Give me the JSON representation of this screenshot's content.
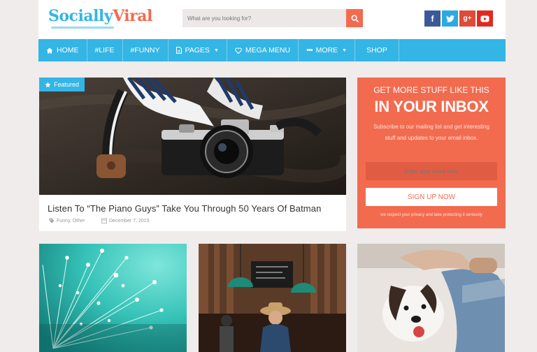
{
  "header": {
    "logo_part1": "Socially",
    "logo_part2": "Viral",
    "search_placeholder": "What are you looking for?",
    "social": [
      "f",
      "t",
      "g+",
      "youtube"
    ]
  },
  "nav": {
    "items": [
      {
        "label": "HOME",
        "icon": "home-icon"
      },
      {
        "label": "#LIFE"
      },
      {
        "label": "#FUNNY"
      },
      {
        "label": "PAGES",
        "icon": "file-icon",
        "dropdown": true
      },
      {
        "label": "MEGA MENU",
        "icon": "heart-icon"
      },
      {
        "label": "MORE",
        "icon": "ellipsis-icon",
        "dropdown": true
      },
      {
        "label": "SHOP"
      }
    ]
  },
  "featured": {
    "badge": "Featured",
    "title": "Listen To “The Piano Guys” Take You Through 50 Years Of Batman",
    "categories": "Funny, Other",
    "date": "December 7, 2015"
  },
  "newsletter": {
    "heading1": "GET MORE STUFF LIKE THIS",
    "heading2": "IN YOUR INBOX",
    "description": "Subscribe to our mailing list and get interesting stuff and updates to your email inbox.",
    "email_placeholder": "Enter your email here",
    "button": "SIGN UP NOW",
    "note": "we respect your privacy and take protecting it seriously"
  },
  "colors": {
    "accent_blue": "#33b5e5",
    "accent_orange": "#f26b4f",
    "background": "#efeceb"
  }
}
